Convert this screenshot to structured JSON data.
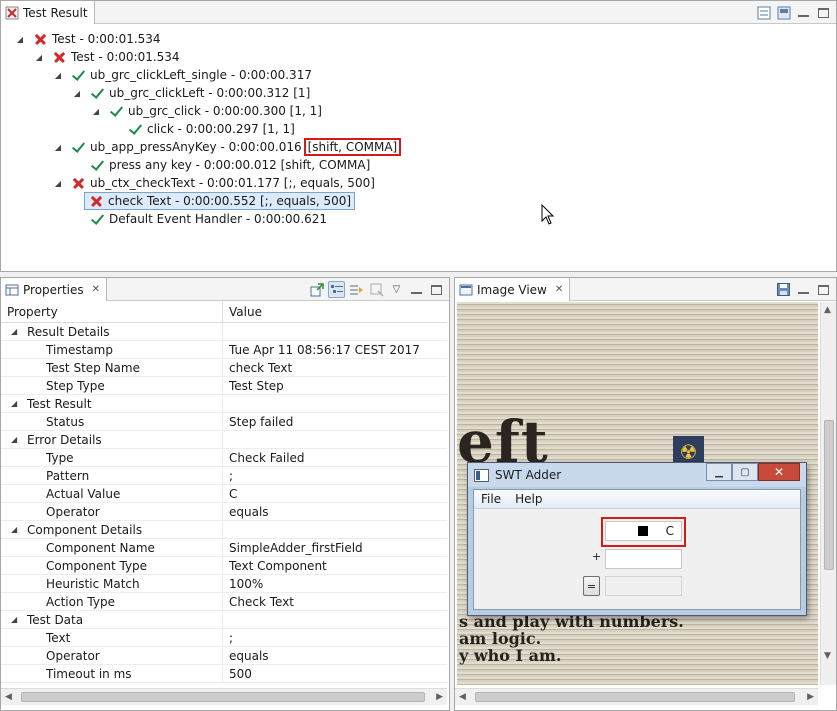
{
  "test_result": {
    "tab_label": "Test Result",
    "tree": [
      {
        "label": "Test - 0:00:01.534",
        "status": "failed",
        "expanded": true
      },
      {
        "label": "Test - 0:00:01.534",
        "status": "failed",
        "expanded": true
      },
      {
        "label": "ub_grc_clickLeft_single - 0:00:00.317",
        "status": "passed",
        "expanded": true
      },
      {
        "label": "ub_grc_clickLeft - 0:00:00.312 [1]",
        "status": "passed",
        "expanded": true
      },
      {
        "label": "ub_grc_click - 0:00:00.300 [1, 1]",
        "status": "passed",
        "expanded": true
      },
      {
        "label": "click - 0:00:00.297 [1, 1]",
        "status": "passed",
        "expanded": null
      },
      {
        "label": "ub_app_pressAnyKey - 0:00:00.016",
        "label_highlight": "[shift, COMMA]",
        "status": "passed",
        "expanded": true
      },
      {
        "label": "press any key - 0:00:00.012 [shift, COMMA]",
        "status": "passed",
        "expanded": null
      },
      {
        "label": "ub_ctx_checkText - 0:00:01.177 [;, equals, 500]",
        "status": "failed",
        "expanded": true
      },
      {
        "label": "check Text - 0:00:00.552 [;, equals, 500]",
        "status": "failed",
        "expanded": null,
        "selected": true
      },
      {
        "label": "Default Event Handler - 0:00:00.621",
        "status": "passed",
        "expanded": null
      }
    ]
  },
  "properties": {
    "tab_label": "Properties",
    "col_property": "Property",
    "col_value": "Value",
    "rows": [
      {
        "key": "Result Details",
        "value": "",
        "category": true
      },
      {
        "key": "Timestamp",
        "value": "Tue Apr 11 08:56:17 CEST 2017"
      },
      {
        "key": "Test Step Name",
        "value": "check Text"
      },
      {
        "key": "Step Type",
        "value": "Test Step"
      },
      {
        "key": "Test Result",
        "value": "",
        "category": true
      },
      {
        "key": "Status",
        "value": "Step failed"
      },
      {
        "key": "Error Details",
        "value": "",
        "category": true
      },
      {
        "key": "Type",
        "value": "Check Failed"
      },
      {
        "key": "Pattern",
        "value": ";"
      },
      {
        "key": "Actual Value",
        "value": "C"
      },
      {
        "key": "Operator",
        "value": "equals"
      },
      {
        "key": "Component Details",
        "value": "",
        "category": true
      },
      {
        "key": "Component Name",
        "value": "SimpleAdder_firstField"
      },
      {
        "key": "Component Type",
        "value": "Text Component"
      },
      {
        "key": "Heuristic Match",
        "value": "100%"
      },
      {
        "key": "Action Type",
        "value": "Check Text"
      },
      {
        "key": "Test Data",
        "value": "",
        "category": true
      },
      {
        "key": "Text",
        "value": ";"
      },
      {
        "key": "Operator",
        "value": "equals"
      },
      {
        "key": "Timeout in ms",
        "value": "500"
      }
    ]
  },
  "image_view": {
    "tab_label": "Image View",
    "background_text": {
      "big_word": "eft",
      "line1": "s and play with numbers.",
      "line2": "am logic.",
      "line3": "y who I am."
    },
    "swt_window": {
      "title": "SWT Adder",
      "menu": [
        "File",
        "Help"
      ],
      "first_field_value": "C",
      "plus_label": "+",
      "equals_label": "=",
      "close_glyph": "✕",
      "min_glyph": "▁",
      "max_glyph": "▢"
    }
  }
}
